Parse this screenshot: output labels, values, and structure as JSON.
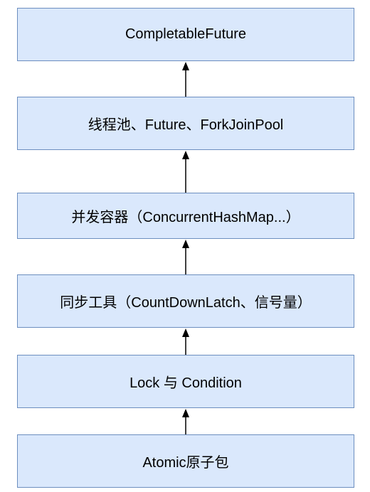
{
  "diagram": {
    "layers": [
      {
        "label": "CompletableFuture"
      },
      {
        "label": "线程池、Future、ForkJoinPool"
      },
      {
        "label": "并发容器（ConcurrentHashMap...）"
      },
      {
        "label": "同步工具（CountDownLatch、信号量）"
      },
      {
        "label": "Lock 与 Condition"
      },
      {
        "label": "Atomic原子包"
      }
    ],
    "colors": {
      "box_fill": "#dae8fc",
      "box_stroke": "#6c8ebf",
      "arrow": "#000000"
    }
  }
}
